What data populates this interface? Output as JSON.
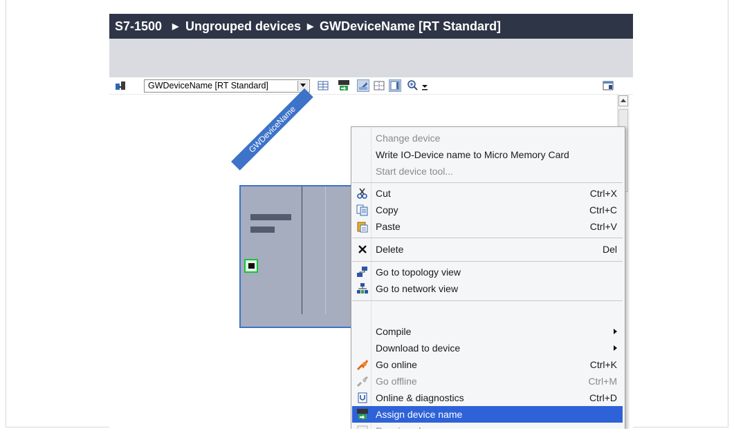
{
  "breadcrumb": {
    "items": [
      "S7-1500",
      "Ungrouped devices",
      "GWDeviceName [RT Standard]"
    ],
    "separator": "▶"
  },
  "toolbar": {
    "device_select": {
      "value": "GWDeviceName [RT Standard]"
    },
    "icons": [
      "device-view-icon",
      "io-grid-icon",
      "assign-name-icon",
      "labels-icon",
      "page-break-icon",
      "overview-icon",
      "zoom-icon",
      "zoom-dropdown-icon",
      "properties-panel-icon"
    ]
  },
  "canvas": {
    "device_label": "GWDeviceName"
  },
  "context_menu": {
    "groups": [
      [
        {
          "label": "Change device",
          "disabled": true
        },
        {
          "label": "Write IO-Device name to Micro Memory Card",
          "disabled": false
        },
        {
          "label": "Start device tool...",
          "disabled": true
        }
      ],
      [
        {
          "label": "Cut",
          "shortcut": "Ctrl+X",
          "icon": "scissors-icon"
        },
        {
          "label": "Copy",
          "shortcut": "Ctrl+C",
          "icon": "copy-icon"
        },
        {
          "label": "Paste",
          "shortcut": "Ctrl+V",
          "icon": "paste-icon"
        }
      ],
      [
        {
          "label": "Delete",
          "shortcut": "Del",
          "icon": "delete-x-icon"
        }
      ],
      [
        {
          "label": "Go to topology view",
          "icon": "topology-view-icon"
        },
        {
          "label": "Go to network view",
          "icon": "network-view-icon"
        }
      ],
      [
        {
          "label": "Compile",
          "submenu": true
        },
        {
          "label": "Download to device",
          "submenu": true
        },
        {
          "label": "Go online",
          "shortcut": "Ctrl+K",
          "icon": "go-online-icon"
        },
        {
          "label": "Go offline",
          "shortcut": "Ctrl+M",
          "icon": "go-offline-icon",
          "disabled": true
        },
        {
          "label": "Online & diagnostics",
          "shortcut": "Ctrl+D",
          "icon": "diagnostics-icon"
        },
        {
          "label": "Assign device name",
          "icon": "assign-name-icon",
          "selected": true
        },
        {
          "label": "Receive alarms",
          "icon": "checkbox-icon",
          "disabled": true
        }
      ]
    ]
  },
  "colors": {
    "title_bar": "#2e3547",
    "selection": "#2e62d8",
    "device_fill": "#a6adbf",
    "device_border": "#3d73c8",
    "port_border": "#17c33b"
  }
}
